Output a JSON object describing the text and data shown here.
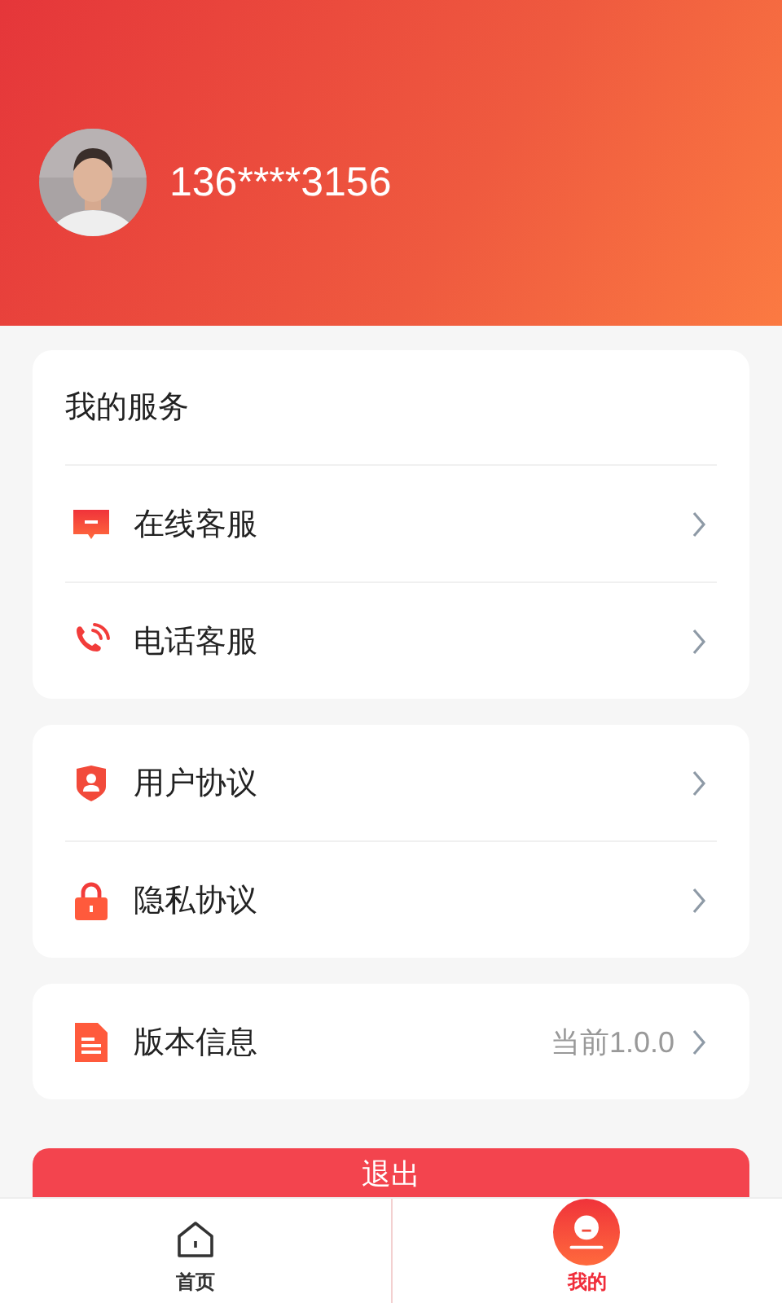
{
  "profile": {
    "phone": "136****3156"
  },
  "sections": [
    {
      "title": "我的服务",
      "items": [
        {
          "label": "在线客服"
        },
        {
          "label": "电话客服"
        }
      ]
    },
    {
      "items": [
        {
          "label": "用户协议"
        },
        {
          "label": "隐私协议"
        }
      ]
    },
    {
      "items": [
        {
          "label": "版本信息",
          "value": "当前1.0.0"
        }
      ]
    }
  ],
  "logout_button": "退出",
  "tab_bar": [
    {
      "label": "首页",
      "selected": false
    },
    {
      "label": "我的",
      "selected": true
    }
  ]
}
